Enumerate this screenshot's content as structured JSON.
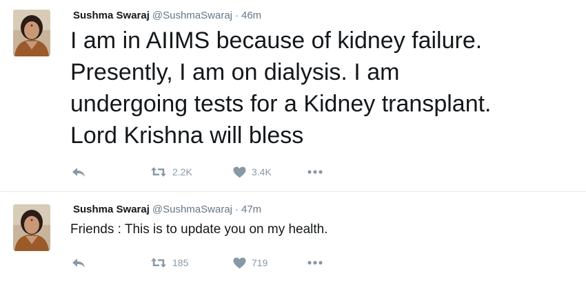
{
  "tweets": [
    {
      "author": {
        "name": "Sushma Swaraj",
        "handle": "@SushmaSwaraj",
        "avatar_icon": "profile-photo"
      },
      "separator": "·",
      "time": "46m",
      "text": "I am in AIIMS because of kidney failure.\nPresently, I am on dialysis. I am\nundergoing tests for a Kidney transplant.\nLord Krishna will bless",
      "retweets": "2.2K",
      "likes": "3.4K"
    },
    {
      "author": {
        "name": "Sushma Swaraj",
        "handle": "@SushmaSwaraj",
        "avatar_icon": "profile-photo"
      },
      "separator": "·",
      "time": "47m",
      "text": "Friends : This is to update you on my health.",
      "retweets": "185",
      "likes": "719"
    }
  ],
  "icons": {
    "reply": "reply-icon",
    "retweet": "retweet-icon",
    "like": "heart-icon",
    "more": "more-icon"
  },
  "colors": {
    "text": "#14171a",
    "secondary": "#657786",
    "action": "#8899a6",
    "divider": "#e6ecf0"
  }
}
